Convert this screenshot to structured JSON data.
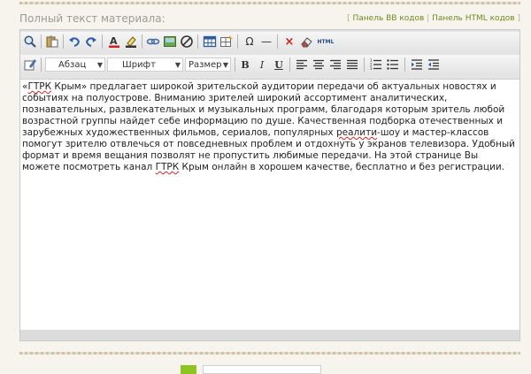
{
  "field": {
    "label": "Полный текст материала:"
  },
  "mode_links": {
    "open": "[",
    "bb_label": "Панель BB кодов",
    "separator": "|",
    "html_label": "Панель HTML кодов",
    "close": "]"
  },
  "toolbar1": {
    "buttons": [
      {
        "name": "preview-icon",
        "tooltip": ""
      },
      {
        "name": "paste-icon",
        "tooltip": ""
      },
      {
        "name": "undo-icon",
        "tooltip": ""
      },
      {
        "name": "redo-icon",
        "tooltip": ""
      },
      {
        "name": "text-color-icon",
        "glyph": "A"
      },
      {
        "name": "highlight-icon",
        "tooltip": ""
      },
      {
        "name": "link-icon",
        "tooltip": ""
      },
      {
        "name": "image-icon",
        "tooltip": ""
      },
      {
        "name": "unlink-icon",
        "tooltip": ""
      },
      {
        "name": "table-icon",
        "tooltip": ""
      },
      {
        "name": "table-insert-icon",
        "tooltip": ""
      },
      {
        "name": "special-char-icon",
        "glyph": "Ω"
      },
      {
        "name": "horizontal-rule-icon",
        "glyph": "—"
      },
      {
        "name": "remove-format-icon",
        "glyph": "×"
      },
      {
        "name": "eraser-icon",
        "tooltip": ""
      },
      {
        "name": "html-source-icon",
        "glyph": "HTML"
      }
    ]
  },
  "toolbar2": {
    "paragraph_select": "Абзац",
    "font_select": "Шрифт",
    "size_select": "Размер",
    "bold": "B",
    "italic": "I",
    "underline": "U"
  },
  "content": {
    "before_link": "«",
    "word1": "ГТРК",
    "text1": " Крым» предлагает широкой зрительской аудитории передачи об актуальных новостях и событиях на полуострове. Вниманию зрителей широкий ассортимент аналитических, познавательных, развлекательных и музыкальных программ, благодаря которым зритель любой возрастной группы найдет себе информацию по душе. Качественная подборка отечественных и зарубежных художественных фильмов, сериалов, популярных ",
    "word2": "реалити",
    "text2": "-шоу и мастер-классов помогут зрителю отвлечься от повседневных проблем и отдохнуть у экранов телевизора. Удобный формат и время вещания позволят не пропустить любимые передачи. На этой странице Вы можете посмотреть канал ",
    "word3": "ГТРК",
    "text3": " Крым онлайн в хорошем качестве, бесплатно и без регистрации."
  },
  "colors": {
    "accent_green": "#6f8a1e",
    "editor_bg": "#e3e3e3",
    "text": "#222222"
  }
}
